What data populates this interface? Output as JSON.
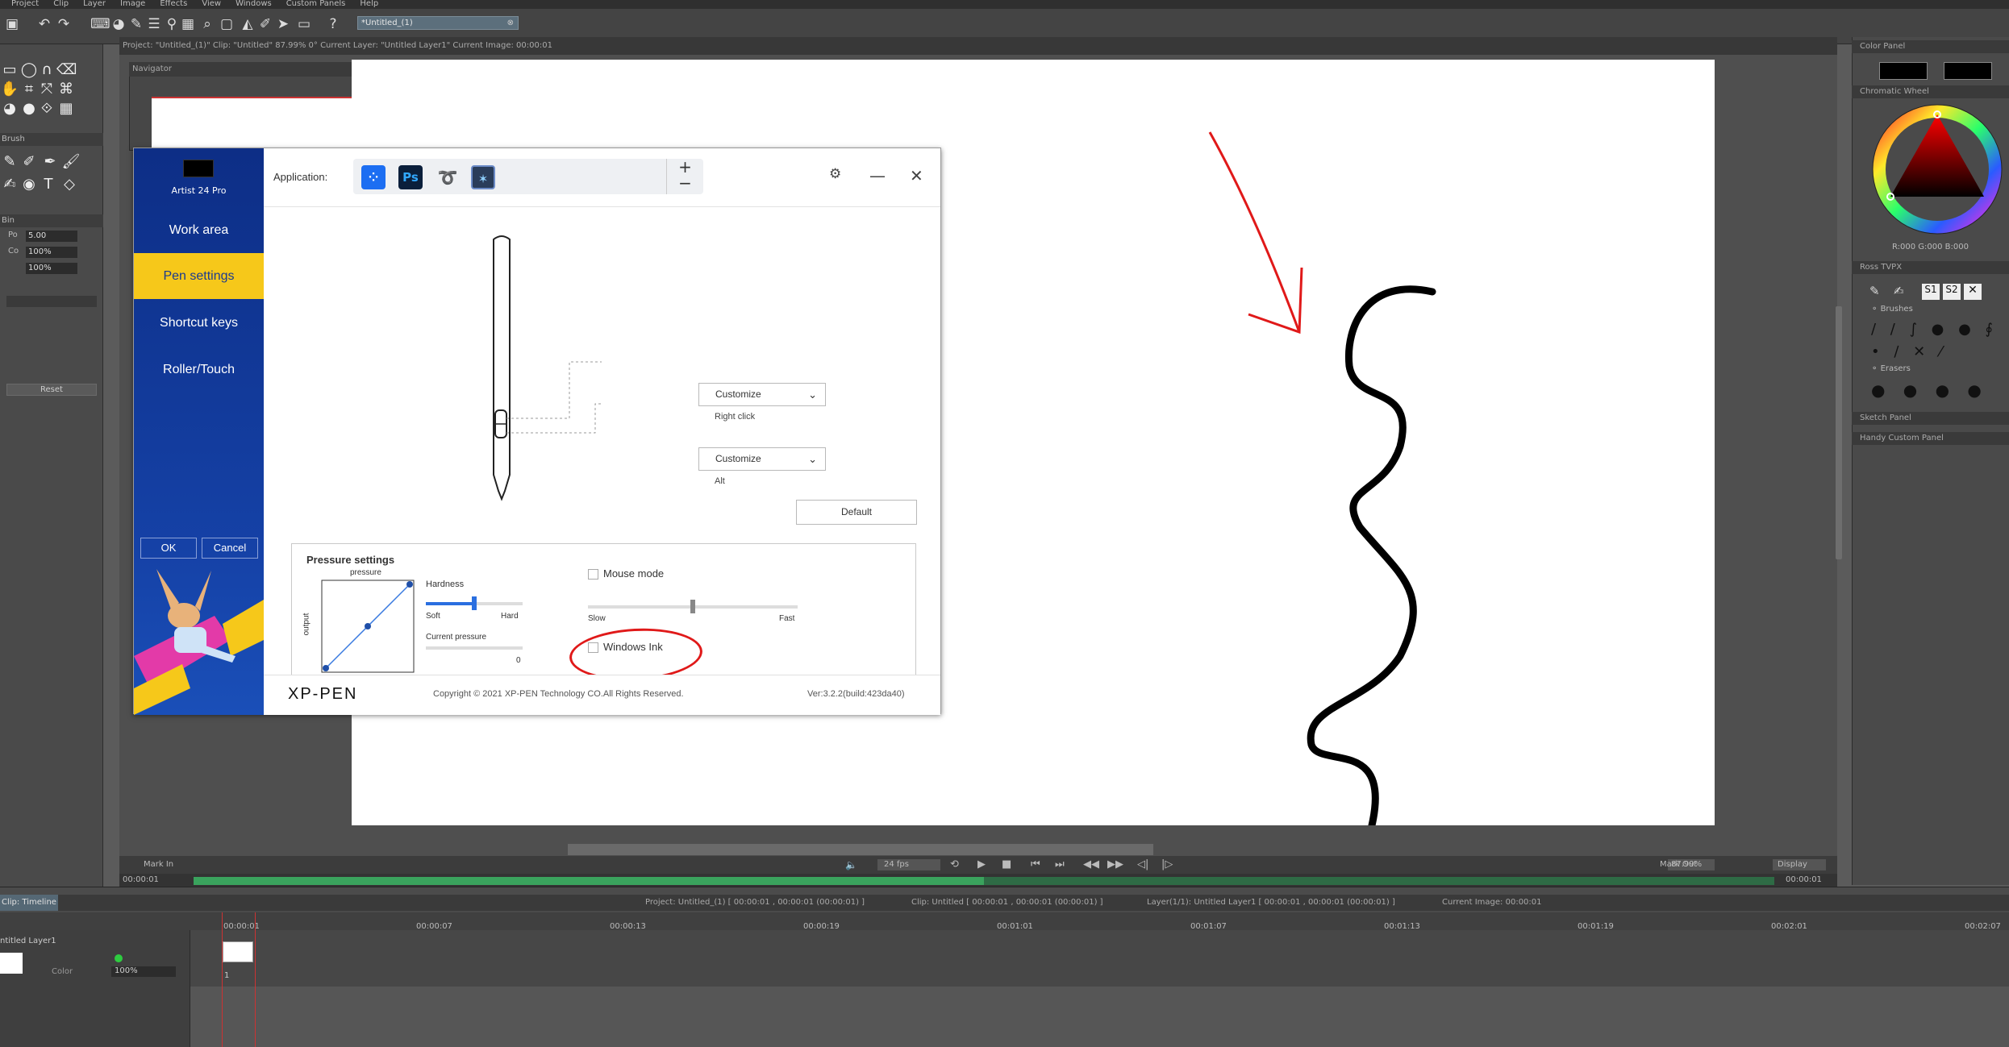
{
  "menu": [
    "Project",
    "Clip",
    "Layer",
    "Image",
    "Effects",
    "View",
    "Windows",
    "Custom Panels",
    "Help"
  ],
  "doc_tab": "*Untitled_(1)",
  "info_bar": "Project: \"Untitled_(1)\"  Clip: \"Untitled\"  87.99%  0°  Current Layer: \"Untitled Layer1\"  Current Image: 00:00:01",
  "navigator": {
    "title": "Navigator"
  },
  "left": {
    "brush_title": "Brush",
    "bin_title": "Bin",
    "rows": [
      {
        "label": "Po",
        "value": "5.00"
      },
      {
        "label": "Co",
        "value": "100%"
      },
      {
        "label": "",
        "value": "100%"
      }
    ],
    "reset": "Reset"
  },
  "view_bottom": {
    "mark_in": "Mark In",
    "mark_out": "Mark Out",
    "time_in": "00:00:01",
    "time_out": "00:00:01",
    "fps": "24 fps",
    "zoom": "87.99%",
    "display": "Display"
  },
  "right": {
    "color_panel": "Color Panel",
    "wheel_title": "Chromatic Wheel",
    "rgb": "R:000 G:000 B:000",
    "ross_title": "Ross TVPX",
    "brushes": "Brushes",
    "erasers": "Erasers",
    "sketch": "Sketch Panel",
    "handy": "Handy Custom Panel"
  },
  "timeline": {
    "tab": "Clip: Timeline",
    "project": "Project: Untitled_(1) [ 00:00:01 , 00:00:01  (00:00:01) ]",
    "clip": "Clip: Untitled [ 00:00:01 , 00:00:01  (00:00:01) ]",
    "layer": "Layer(1/1): Untitled Layer1 [ 00:00:01 , 00:00:01  (00:00:01) ]",
    "current": "Current Image: 00:00:01",
    "ticks": [
      "00:00:01",
      "00:00:07",
      "00:00:13",
      "00:00:19",
      "00:01:01",
      "00:01:07",
      "00:01:13",
      "00:01:19",
      "00:02:01",
      "00:02:07"
    ],
    "layer_name": "ntitled Layer1",
    "color_label": "Color",
    "opacity": "100%",
    "frame_num": "1"
  },
  "dialog": {
    "device": "Artist 24 Pro",
    "nav": [
      "Work area",
      "Pen settings",
      "Shortcut keys",
      "Roller/Touch"
    ],
    "ok": "OK",
    "cancel": "Cancel",
    "app_label": "Application:",
    "apps": [
      "Ps"
    ],
    "upper_button": {
      "value": "Customize",
      "sub": "Right click"
    },
    "lower_button": {
      "value": "Customize",
      "sub": "Alt"
    },
    "default": "Default",
    "pressure": {
      "title": "Pressure settings",
      "top": "pressure",
      "side": "output",
      "hardness": "Hardness",
      "soft": "Soft",
      "hard": "Hard",
      "current": "Current pressure",
      "current_val": "0",
      "hardness_level": 0.5
    },
    "mouse_mode": "Mouse mode",
    "slow": "Slow",
    "fast": "Fast",
    "mouse_speed": 0.5,
    "windows_ink": "Windows Ink",
    "brand": "XP-PEN",
    "copyright": "Copyright © 2021 XP-PEN Technology CO.All Rights Reserved.",
    "version": "Ver:3.2.2(build:423da40)"
  },
  "colors": {
    "accent": "#f6c81a",
    "sidebar": "#1541a6",
    "annotation": "#e01919"
  }
}
